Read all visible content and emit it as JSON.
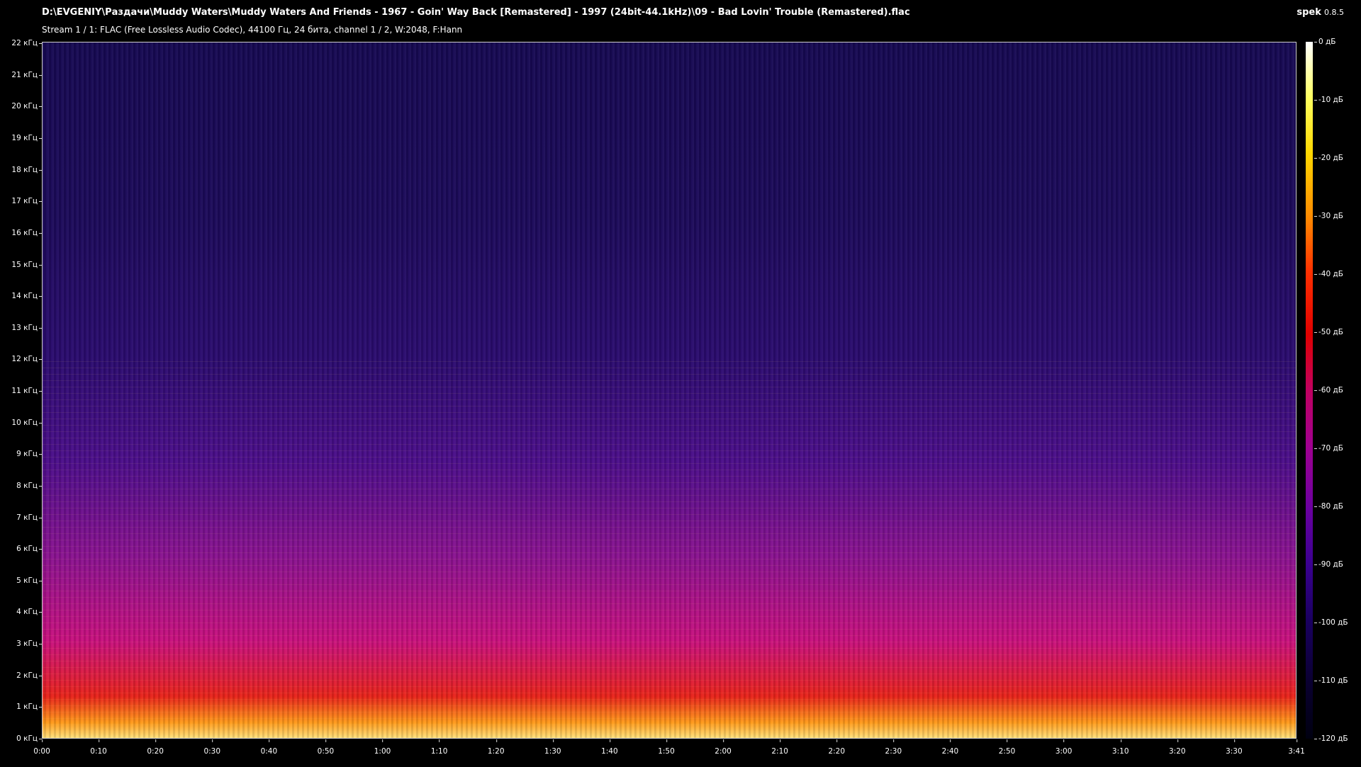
{
  "header": {
    "file_path": "D:\\EVGENIY\\Раздачи\\Muddy Waters\\Muddy Waters And Friends - 1967 - Goin' Way Back [Remastered] - 1997 (24bit-44.1kHz)\\09 - Bad Lovin' Trouble (Remastered).flac",
    "stream_info": "Stream 1 / 1: FLAC (Free Lossless Audio Codec), 44100 Гц, 24 бита, channel 1 / 2, W:2048, F:Hann",
    "app_name": "spek",
    "app_version": "0.8.5"
  },
  "frequency_axis": {
    "labels": [
      "22 кГц",
      "21 кГц",
      "20 кГц",
      "19 кГц",
      "18 кГц",
      "17 кГц",
      "16 кГц",
      "15 кГц",
      "14 кГц",
      "13 кГц",
      "12 кГц",
      "11 кГц",
      "10 кГц",
      "9 кГц",
      "8 кГц",
      "7 кГц",
      "6 кГц",
      "5 кГц",
      "4 кГц",
      "3 кГц",
      "2 кГц",
      "1 кГц",
      "0 кГц"
    ],
    "values_khz": [
      22,
      21,
      20,
      19,
      18,
      17,
      16,
      15,
      14,
      13,
      12,
      11,
      10,
      9,
      8,
      7,
      6,
      5,
      4,
      3,
      2,
      1,
      0
    ],
    "max_khz": 22.05
  },
  "time_axis": {
    "labels": [
      "0:00",
      "0:10",
      "0:20",
      "0:30",
      "0:40",
      "0:50",
      "1:00",
      "1:10",
      "1:20",
      "1:30",
      "1:40",
      "1:50",
      "2:00",
      "2:10",
      "2:20",
      "2:30",
      "2:40",
      "2:50",
      "3:00",
      "3:10",
      "3:20",
      "3:30",
      "3:41"
    ],
    "values_sec": [
      0,
      10,
      20,
      30,
      40,
      50,
      60,
      70,
      80,
      90,
      100,
      110,
      120,
      130,
      140,
      150,
      160,
      170,
      180,
      190,
      200,
      210,
      221
    ],
    "duration_sec": 221
  },
  "db_scale": {
    "labels": [
      "0 дБ",
      "-10 дБ",
      "-20 дБ",
      "-30 дБ",
      "-40 дБ",
      "-50 дБ",
      "-60 дБ",
      "-70 дБ",
      "-80 дБ",
      "-90 дБ",
      "-100 дБ",
      "-110 дБ",
      "-120 дБ"
    ],
    "values_db": [
      0,
      -10,
      -20,
      -30,
      -40,
      -50,
      -60,
      -70,
      -80,
      -90,
      -100,
      -110,
      -120
    ],
    "min_db": -120
  }
}
